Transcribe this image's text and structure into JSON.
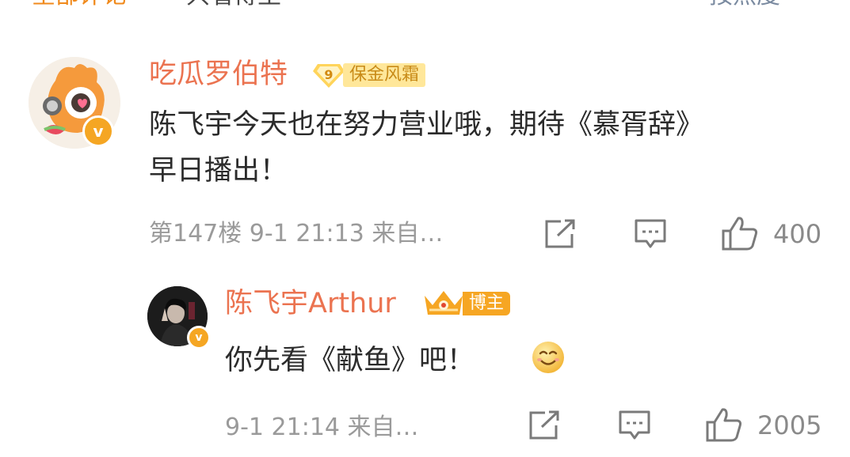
{
  "header": {
    "tab_all": "全部评论",
    "tab_host_only": "只看博主",
    "sort": "按热度"
  },
  "comment": {
    "username": "吃瓜罗伯特",
    "fan_level": "9",
    "fan_badge_label": "保金风霜",
    "text_line1": "陈飞宇今天也在努力营业哦，期待《慕胥辞》",
    "text_line2": "早日播出！",
    "meta": "第147楼 9-1 21:13 来自…",
    "like_count": "400"
  },
  "reply": {
    "username": "陈飞宇Arthur",
    "host_badge_label": "博主",
    "text": "你先看《献鱼》吧！",
    "meta": "9-1 21:14 来自…",
    "like_count": "2005"
  },
  "colors": {
    "username": "#eb7350",
    "verified_badge": "#f5a623",
    "meta_text": "#9a9a9a",
    "comment_text": "#2b2b2b"
  },
  "icons": {
    "share": "share-icon",
    "comment": "comment-icon",
    "like": "thumbs-up-icon",
    "verified": "verified-v-icon",
    "emoji": "smile-emoji-icon"
  }
}
